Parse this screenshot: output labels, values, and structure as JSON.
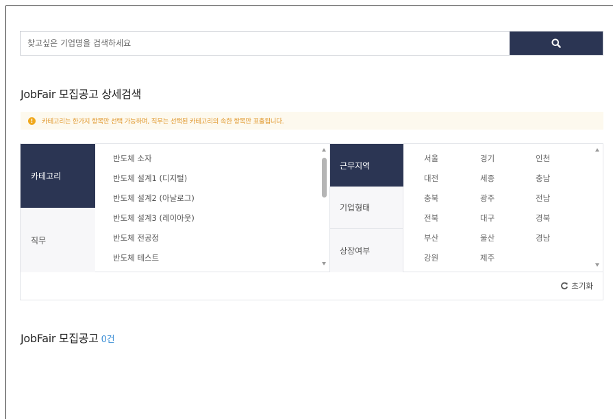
{
  "search": {
    "placeholder": "찾고싶은 기업명을 검색하세요",
    "value": ""
  },
  "detail_title": "JobFair 모집공고 상세검색",
  "notice": "카테고리는 한가지 항목만 선택 가능하며, 직무는 선택된 카테고리의 속한 항목만 표출됩니다.",
  "left_tabs": [
    {
      "label": "카테고리",
      "active": true
    },
    {
      "label": "직무",
      "active": false
    }
  ],
  "category_items": [
    "반도체 소자",
    "반도체 설계1 (디지털)",
    "반도체 설계2 (아날로그)",
    "반도체 설계3 (레이아웃)",
    "반도체 전공정",
    "반도체 테스트"
  ],
  "mid_tabs": [
    {
      "label": "근무지역",
      "active": true
    },
    {
      "label": "기업형태",
      "active": false
    },
    {
      "label": "상장여부",
      "active": false
    }
  ],
  "regions": [
    [
      "서울",
      "경기",
      "인천"
    ],
    [
      "대전",
      "세종",
      "충남"
    ],
    [
      "충북",
      "광주",
      "전남"
    ],
    [
      "전북",
      "대구",
      "경북"
    ],
    [
      "부산",
      "울산",
      "경남"
    ],
    [
      "강원",
      "제주"
    ]
  ],
  "reset_label": "초기화",
  "result": {
    "title": "JobFair 모집공고",
    "count": "0건"
  },
  "colors": {
    "navy": "#2b3553",
    "notice_text": "#e0962a",
    "count": "#3d8fd6"
  },
  "icons": {
    "search": "search-icon",
    "notice": "info-icon",
    "reset": "refresh-icon"
  }
}
